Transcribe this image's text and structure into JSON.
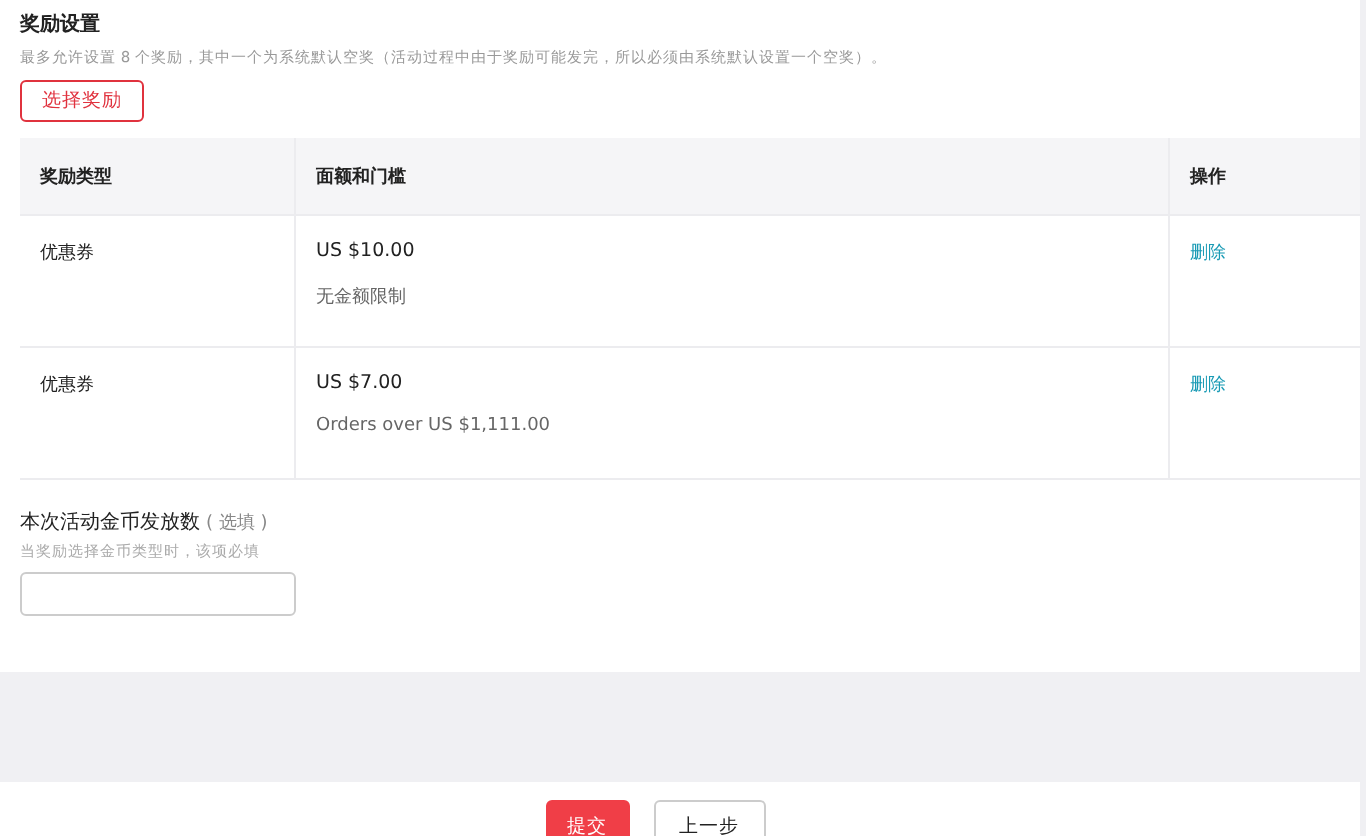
{
  "section": {
    "title": "奖励设置",
    "description": "最多允许设置 8 个奖励，其中一个为系统默认空奖（活动过程中由于奖励可能发完，所以必须由系统默认设置一个空奖）。",
    "select_button": "选择奖励"
  },
  "table": {
    "columns": [
      "奖励类型",
      "面额和门槛",
      "操作"
    ],
    "rows": [
      {
        "type": "优惠券",
        "amount": "US $10.00",
        "threshold": "无金额限制",
        "action": "删除"
      },
      {
        "type": "优惠券",
        "amount": "US $7.00",
        "threshold": "Orders over US $1,111.00",
        "action": "删除"
      }
    ]
  },
  "coins": {
    "label": "本次活动金币发放数",
    "optional": "( 选填 )",
    "hint": "当奖励选择金币类型时，该项必填"
  },
  "footer": {
    "buttons": [
      {
        "label": "提交",
        "kind": "primary"
      },
      {
        "label": "上一步",
        "kind": "secondary"
      }
    ]
  }
}
